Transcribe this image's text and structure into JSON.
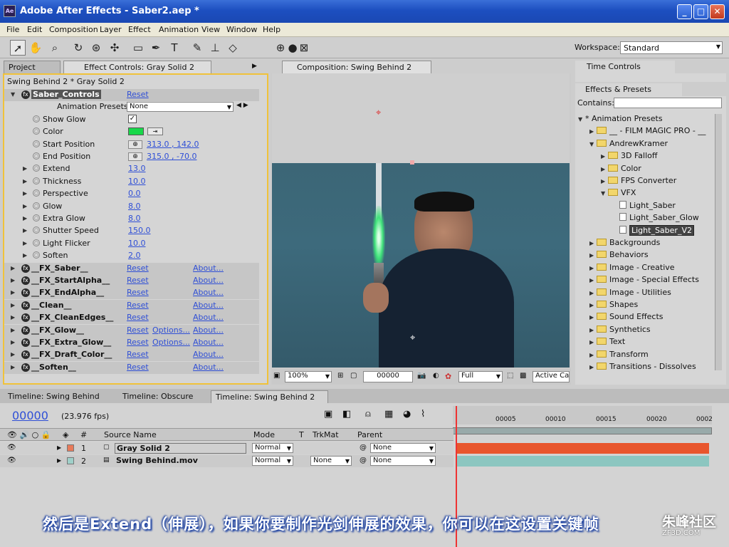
{
  "window": {
    "title": "Adobe After Effects - Saber2.aep *"
  },
  "menu": [
    "File",
    "Edit",
    "Composition",
    "Layer",
    "Effect",
    "Animation",
    "View",
    "Window",
    "Help"
  ],
  "workspace": {
    "label": "Workspace:",
    "value": "Standard"
  },
  "left_tabs": {
    "project": "Project",
    "effect_controls": "Effect Controls: Gray Solid 2"
  },
  "effect_controls": {
    "breadcrumb": "Swing Behind 2 * Gray Solid 2",
    "effect_name": "Saber_Controls",
    "reset": "Reset",
    "about": "About...",
    "options": "Options...",
    "presets_label": "Animation Presets:",
    "presets_value": "None",
    "props": [
      {
        "name": "Show Glow",
        "value": "✓"
      },
      {
        "name": "Color",
        "value": ""
      },
      {
        "name": "Start Position",
        "value": "313.0 , 142.0"
      },
      {
        "name": "End Position",
        "value": "315.0 , -70.0"
      },
      {
        "name": "Extend",
        "value": "13.0"
      },
      {
        "name": "Thickness",
        "value": "10.0"
      },
      {
        "name": "Perspective",
        "value": "0.0"
      },
      {
        "name": "Glow",
        "value": "8.0"
      },
      {
        "name": "Extra Glow",
        "value": "8.0"
      },
      {
        "name": "Shutter Speed",
        "value": "150.0"
      },
      {
        "name": "Light Flicker",
        "value": "10.0"
      },
      {
        "name": "Soften",
        "value": "2.0"
      }
    ],
    "fx": [
      {
        "name": "__FX_Saber__",
        "options": false
      },
      {
        "name": "__FX_StartAlpha__",
        "options": false
      },
      {
        "name": "__FX_EndAlpha__",
        "options": false
      },
      {
        "name": "__Clean__",
        "options": false
      },
      {
        "name": "__FX_CleanEdges__",
        "options": false
      },
      {
        "name": "__FX_Glow__",
        "options": true
      },
      {
        "name": "__FX_Extra_Glow__",
        "options": true
      },
      {
        "name": "__FX_Draft_Color__",
        "options": false
      },
      {
        "name": "__Soften__",
        "options": false
      }
    ]
  },
  "composition": {
    "tab": "Composition: Swing Behind 2",
    "zoom": "100%",
    "timecode": "00000",
    "resolution": "Full",
    "camera": "Active Ca"
  },
  "right_panels": {
    "time_controls": "Time Controls",
    "effects_presets": "Effects & Presets",
    "contains_label": "Contains:",
    "tree": [
      {
        "label": "* Animation Presets",
        "level": 0,
        "kind": "root",
        "open": true
      },
      {
        "label": "__ - FILM MAGIC PRO - __",
        "level": 1,
        "kind": "folder",
        "open": false
      },
      {
        "label": "AndrewKramer",
        "level": 1,
        "kind": "folder",
        "open": true
      },
      {
        "label": "3D Falloff",
        "level": 2,
        "kind": "folder",
        "open": false
      },
      {
        "label": "Color",
        "level": 2,
        "kind": "folder",
        "open": false
      },
      {
        "label": "FPS Converter",
        "level": 2,
        "kind": "folder",
        "open": false
      },
      {
        "label": "VFX",
        "level": 2,
        "kind": "folder",
        "open": true
      },
      {
        "label": "Light_Saber",
        "level": 3,
        "kind": "preset"
      },
      {
        "label": "Light_Saber_Glow",
        "level": 3,
        "kind": "preset"
      },
      {
        "label": "Light_Saber_V2",
        "level": 3,
        "kind": "preset",
        "selected": true
      },
      {
        "label": "Backgrounds",
        "level": 1,
        "kind": "folder",
        "open": false
      },
      {
        "label": "Behaviors",
        "level": 1,
        "kind": "folder",
        "open": false
      },
      {
        "label": "Image - Creative",
        "level": 1,
        "kind": "folder",
        "open": false
      },
      {
        "label": "Image - Special Effects",
        "level": 1,
        "kind": "folder",
        "open": false
      },
      {
        "label": "Image - Utilities",
        "level": 1,
        "kind": "folder",
        "open": false
      },
      {
        "label": "Shapes",
        "level": 1,
        "kind": "folder",
        "open": false
      },
      {
        "label": "Sound Effects",
        "level": 1,
        "kind": "folder",
        "open": false
      },
      {
        "label": "Synthetics",
        "level": 1,
        "kind": "folder",
        "open": false
      },
      {
        "label": "Text",
        "level": 1,
        "kind": "folder",
        "open": false
      },
      {
        "label": "Transform",
        "level": 1,
        "kind": "folder",
        "open": false
      },
      {
        "label": "Transitions - Dissolves",
        "level": 1,
        "kind": "folder",
        "open": false
      }
    ]
  },
  "timeline": {
    "tabs": [
      "Timeline: Swing Behind",
      "Timeline: Obscure",
      "Timeline: Swing Behind 2"
    ],
    "timecode": "00000",
    "fps": "(23.976 fps)",
    "headers": {
      "num": "#",
      "source": "Source Name",
      "mode": "Mode",
      "t": "T",
      "trkmat": "TrkMat",
      "parent": "Parent"
    },
    "ruler": [
      "00005",
      "00010",
      "00015",
      "00020",
      "0002"
    ],
    "layers": [
      {
        "num": "1",
        "name": "Gray Solid 2",
        "mode": "Normal",
        "trkmat": "",
        "parent": "None",
        "color": "#e87a5a",
        "bar": "#e8562d"
      },
      {
        "num": "2",
        "name": "Swing Behind.mov",
        "mode": "Normal",
        "trkmat": "None",
        "parent": "None",
        "color": "#9fd0c9",
        "bar": "#8cc6c0"
      }
    ]
  },
  "subtitle": "然后是Extend（伸展），如果你要制作光剑伸展的效果，你可以在这设置关键帧",
  "watermark": {
    "main": "朱峰社区",
    "sub": "ZF3D.COM"
  },
  "colors": {
    "accent": "#f0c23a",
    "link": "#2f4fd6",
    "saber_glow": "#3fe37a",
    "color_swatch": "#18d84a"
  }
}
